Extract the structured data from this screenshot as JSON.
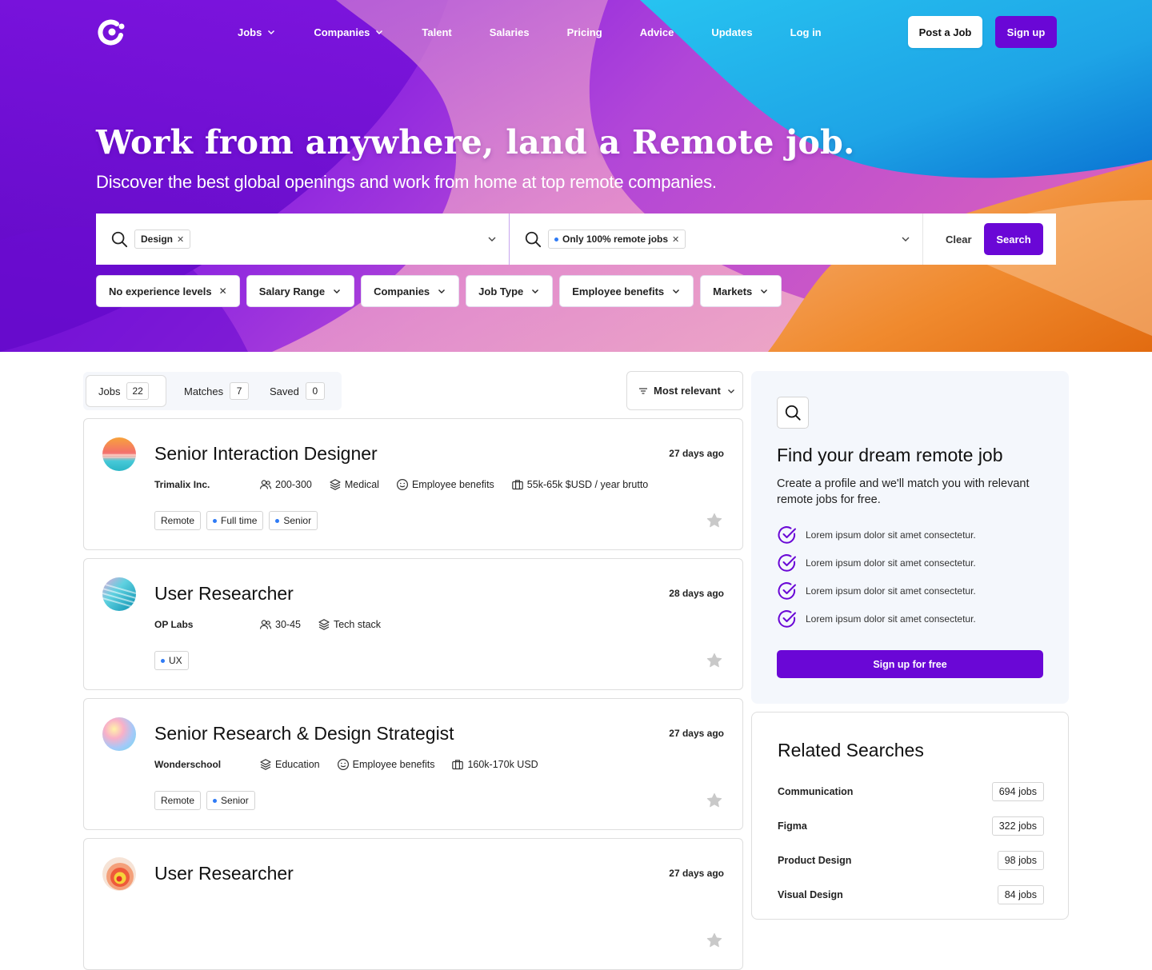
{
  "nav": {
    "links": [
      {
        "label": "Jobs",
        "dropdown": true
      },
      {
        "label": "Companies",
        "dropdown": true
      },
      {
        "label": "Talent",
        "dropdown": false
      },
      {
        "label": "Salaries",
        "dropdown": false
      },
      {
        "label": "Pricing",
        "dropdown": false
      },
      {
        "label": "Advice",
        "dropdown": false
      },
      {
        "label": "Updates",
        "dropdown": false
      },
      {
        "label": "Log in",
        "dropdown": false
      }
    ],
    "post_job_label": "Post a Job",
    "signup_label": "Sign up"
  },
  "hero": {
    "title": "Work from anywhere, land a Remote job.",
    "subtitle": "Discover the best global openings and work from home at top remote companies."
  },
  "search": {
    "keyword_chip": "Design",
    "location_chip": "Only 100% remote jobs",
    "clear_label": "Clear",
    "search_label": "Search"
  },
  "filters": [
    {
      "label": "No experience levels",
      "removable": true
    },
    {
      "label": "Salary Range",
      "removable": false
    },
    {
      "label": "Companies",
      "removable": false
    },
    {
      "label": "Job Type",
      "removable": false
    },
    {
      "label": "Employee benefits",
      "removable": false
    },
    {
      "label": "Markets",
      "removable": false
    }
  ],
  "tabs": [
    {
      "label": "Jobs",
      "count": "22"
    },
    {
      "label": "Matches",
      "count": "7"
    },
    {
      "label": "Saved",
      "count": "0"
    }
  ],
  "sort": {
    "label": "Most relevant"
  },
  "jobs": [
    {
      "title": "Senior Interaction Designer",
      "posted": "27 days ago",
      "company": "Trimalix Inc.",
      "meta": [
        {
          "icon": "people-icon",
          "text": "200-300"
        },
        {
          "icon": "layers-icon",
          "text": "Medical"
        },
        {
          "icon": "smile-icon",
          "text": "Employee benefits"
        },
        {
          "icon": "briefcase-icon",
          "text": "55k-65k $USD / year brutto"
        }
      ],
      "tags": [
        {
          "text": "Remote",
          "dot": false
        },
        {
          "text": "Full time",
          "dot": true
        },
        {
          "text": "Senior",
          "dot": true
        }
      ]
    },
    {
      "title": "User Researcher",
      "posted": "28 days ago",
      "company": "OP Labs",
      "meta": [
        {
          "icon": "people-icon",
          "text": "30-45"
        },
        {
          "icon": "layers-icon",
          "text": "Tech stack"
        }
      ],
      "tags": [
        {
          "text": "UX",
          "dot": true
        }
      ]
    },
    {
      "title": "Senior Research & Design Strategist",
      "posted": "27 days ago",
      "company": "Wonderschool",
      "meta": [
        {
          "icon": "layers-icon",
          "text": "Education"
        },
        {
          "icon": "smile-icon",
          "text": "Employee benefits"
        },
        {
          "icon": "briefcase-icon",
          "text": "160k-170k USD"
        }
      ],
      "tags": [
        {
          "text": "Remote",
          "dot": false
        },
        {
          "text": "Senior",
          "dot": true
        }
      ]
    },
    {
      "title": "User Researcher",
      "posted": "27 days ago",
      "company": "",
      "meta": [],
      "tags": []
    }
  ],
  "promo": {
    "title": "Find your dream remote job",
    "description": "Create a profile and we'll match you with relevant remote jobs for free.",
    "checks": [
      "Lorem ipsum dolor sit amet consectetur.",
      "Lorem ipsum dolor sit amet consectetur.",
      "Lorem ipsum dolor sit amet consectetur.",
      "Lorem ipsum dolor sit amet consectetur."
    ],
    "button_label": "Sign up for free"
  },
  "related": {
    "title": "Related Searches",
    "items": [
      {
        "label": "Communication",
        "count": "694 jobs"
      },
      {
        "label": "Figma",
        "count": "322 jobs"
      },
      {
        "label": "Product Design",
        "count": "98 jobs"
      },
      {
        "label": "Visual Design",
        "count": "84 jobs"
      }
    ]
  },
  "colors": {
    "accent": "#6a07d6",
    "tag_dot": "#2f7bf5",
    "sidebar_bg": "#f4f7fc"
  }
}
